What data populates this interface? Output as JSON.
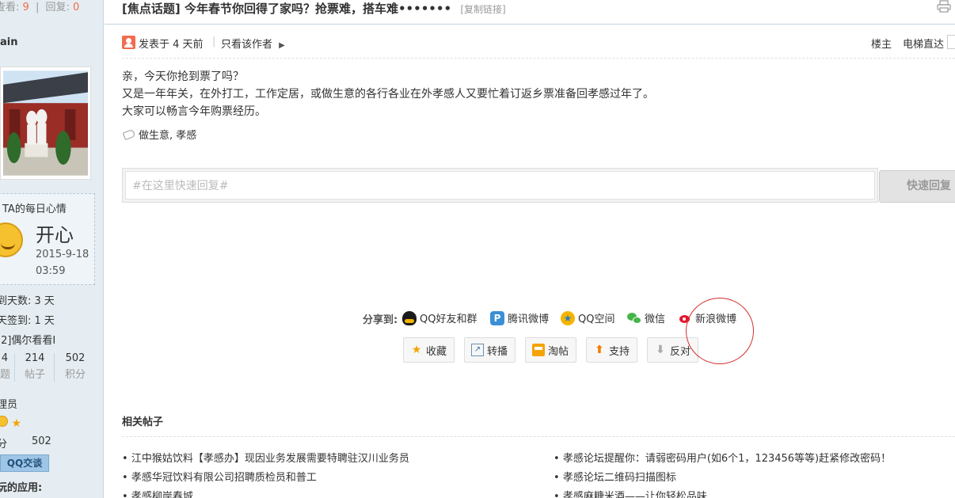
{
  "sidebar": {
    "view_label": "查看:",
    "view_count": "9",
    "reply_label": "回复:",
    "reply_count": "0",
    "username": "ain",
    "mood_title": "TA的每日心情",
    "mood_value": "开心",
    "mood_date": "2015-9-18 03:59",
    "sign_days": "到天数: 3 天",
    "last_sign": "天签到: 1 天",
    "level_line": "[2]偶尔看看I",
    "stats": [
      {
        "value": "4",
        "label": "题"
      },
      {
        "value": "214",
        "label": "帖子"
      },
      {
        "value": "502",
        "label": "积分"
      }
    ],
    "role": "理员",
    "score_label": "分",
    "score_value": "502",
    "qq_button": "QQ交谈",
    "apps_label": "玩的应用:"
  },
  "thread": {
    "tag": "[焦点话题]",
    "title": "今年春节你回得了家吗？抢票难，搭车难•••••••",
    "copy_link": "[复制链接]",
    "posted_at": "发表于 4 天前",
    "author_only": "只看该作者",
    "floor": "楼主",
    "elevator": "电梯直达",
    "content_lines": [
      "亲，今天你抢到票了吗？",
      "又是一年年关，在外打工，工作定居，或做生意的各行各业在外孝感人又要忙着订返乡票准备回孝感过年了。",
      "大家可以畅言今年购票经历。"
    ],
    "tags": "做生意, 孝感"
  },
  "reply": {
    "placeholder": "#在这里快速回复#",
    "button": "快速回复"
  },
  "share": {
    "label": "分享到:",
    "targets": [
      {
        "label": "QQ好友和群",
        "icon": "qq-icon",
        "color": "#2a7cc7"
      },
      {
        "label": "腾讯微博",
        "icon": "tencent-weibo-icon",
        "color": "#3a8fd6"
      },
      {
        "label": "QQ空间",
        "icon": "qzone-icon",
        "color": "#f5b400"
      },
      {
        "label": "微信",
        "icon": "wechat-icon",
        "color": "#44b549"
      },
      {
        "label": "新浪微博",
        "icon": "sina-weibo-icon",
        "color": "#e6162d"
      }
    ]
  },
  "actions": [
    {
      "label": "收藏",
      "icon": "star-icon"
    },
    {
      "label": "转播",
      "icon": "repost-icon"
    },
    {
      "label": "淘帖",
      "icon": "tray-icon"
    },
    {
      "label": "支持",
      "icon": "arrow-up-icon"
    },
    {
      "label": "反对",
      "icon": "arrow-down-icon"
    }
  ],
  "related": {
    "title": "相关帖子",
    "left": [
      "江中猴姑饮料【孝感办】现因业务发展需要特聘驻汉川业务员",
      "孝感华冠饮料有限公司招聘质检员和普工",
      "孝感柳岸春城"
    ],
    "right": [
      "孝感论坛提醒你：请弱密码用户(如6个1，123456等等)赶紧修改密码！",
      "孝感论坛二维码扫描图标",
      "孝感麻糖米酒——让你轻松品味"
    ]
  }
}
